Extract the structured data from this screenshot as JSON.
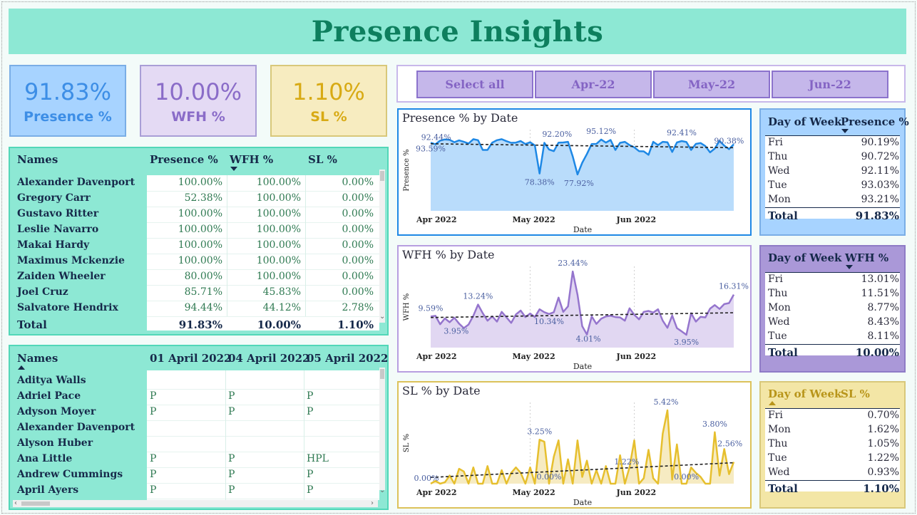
{
  "title": "Presence Insights",
  "kpis": {
    "presence": {
      "value": "91.83%",
      "label": "Presence %"
    },
    "wfh": {
      "value": "10.00%",
      "label": "WFH %"
    },
    "sl": {
      "value": "1.10%",
      "label": "SL %"
    }
  },
  "slicer": {
    "options": [
      "Select all",
      "Apr-22",
      "May-22",
      "Jun-22"
    ]
  },
  "summary_table": {
    "headers": [
      "Names",
      "Presence %",
      "WFH %",
      "SL %"
    ],
    "rows": [
      [
        "Alexander Davenport",
        "100.00%",
        "100.00%",
        "0.00%"
      ],
      [
        "Gregory Carr",
        "52.38%",
        "100.00%",
        "0.00%"
      ],
      [
        "Gustavo Ritter",
        "100.00%",
        "100.00%",
        "0.00%"
      ],
      [
        "Leslie Navarro",
        "100.00%",
        "100.00%",
        "0.00%"
      ],
      [
        "Makai Hardy",
        "100.00%",
        "100.00%",
        "0.00%"
      ],
      [
        "Maximus Mckenzie",
        "100.00%",
        "100.00%",
        "0.00%"
      ],
      [
        "Zaiden Wheeler",
        "80.00%",
        "100.00%",
        "0.00%"
      ],
      [
        "Joel Cruz",
        "85.71%",
        "45.83%",
        "0.00%"
      ],
      [
        "Salvatore Hendrix",
        "94.44%",
        "44.12%",
        "2.78%"
      ]
    ],
    "total": [
      "Total",
      "91.83%",
      "10.00%",
      "1.10%"
    ]
  },
  "attendance_table": {
    "headers": [
      "Names",
      "01 April 2022",
      "04 April 2022",
      "05 April 2022"
    ],
    "rows": [
      [
        "Aditya Walls",
        "",
        "",
        ""
      ],
      [
        "Adriel Pace",
        "P",
        "P",
        "P"
      ],
      [
        "Adyson Moyer",
        "P",
        "P",
        "P"
      ],
      [
        "Alexander Davenport",
        "",
        "",
        ""
      ],
      [
        "Alyson Huber",
        "",
        "",
        ""
      ],
      [
        "Ana Little",
        "P",
        "P",
        "HPL"
      ],
      [
        "Andrew Cummings",
        "P",
        "P",
        "P"
      ],
      [
        "April Ayers",
        "P",
        "P",
        "P"
      ]
    ]
  },
  "dow_tables": {
    "presence": {
      "headers": [
        "Day of Week",
        "Presence %"
      ],
      "rows": [
        [
          "Fri",
          "90.19%"
        ],
        [
          "Thu",
          "90.72%"
        ],
        [
          "Wed",
          "92.11%"
        ],
        [
          "Tue",
          "93.03%"
        ],
        [
          "Mon",
          "93.21%"
        ]
      ],
      "total": [
        "Total",
        "91.83%"
      ]
    },
    "wfh": {
      "headers": [
        "Day of Week",
        "WFH %"
      ],
      "rows": [
        [
          "Fri",
          "13.01%"
        ],
        [
          "Thu",
          "11.51%"
        ],
        [
          "Mon",
          "8.77%"
        ],
        [
          "Wed",
          "8.43%"
        ],
        [
          "Tue",
          "8.11%"
        ]
      ],
      "total": [
        "Total",
        "10.00%"
      ]
    },
    "sl": {
      "headers": [
        "Day of Week",
        "SL %"
      ],
      "rows": [
        [
          "Fri",
          "0.70%"
        ],
        [
          "Mon",
          "1.62%"
        ],
        [
          "Thu",
          "1.05%"
        ],
        [
          "Tue",
          "1.22%"
        ],
        [
          "Wed",
          "0.93%"
        ]
      ],
      "total": [
        "Total",
        "1.10%"
      ]
    }
  },
  "colors": {
    "presence": "#1e88e5",
    "presence_fill": "#b9dcfb",
    "wfh": "#9575cd",
    "wfh_fill": "#e1d7f2",
    "sl": "#e6bf2e",
    "sl_fill": "#f6ebc2"
  },
  "chart_data": [
    {
      "type": "area",
      "title": "Presence % by Date",
      "xlabel": "Date",
      "ylabel": "Presence %",
      "x_ticks": [
        "Apr 2022",
        "May 2022",
        "Jun 2022"
      ],
      "x": [
        "2022-04-01",
        "2022-04-04",
        "2022-04-05",
        "2022-04-06",
        "2022-04-07",
        "2022-04-08",
        "2022-04-11",
        "2022-04-12",
        "2022-04-13",
        "2022-04-14",
        "2022-04-15",
        "2022-04-18",
        "2022-04-19",
        "2022-04-20",
        "2022-04-21",
        "2022-04-22",
        "2022-04-25",
        "2022-04-26",
        "2022-04-27",
        "2022-04-28",
        "2022-04-29",
        "2022-05-02",
        "2022-05-03",
        "2022-05-04",
        "2022-05-05",
        "2022-05-06",
        "2022-05-09",
        "2022-05-10",
        "2022-05-11",
        "2022-05-12",
        "2022-05-13",
        "2022-05-16",
        "2022-05-17",
        "2022-05-18",
        "2022-05-19",
        "2022-05-20",
        "2022-05-23",
        "2022-05-24",
        "2022-05-25",
        "2022-05-26",
        "2022-05-27",
        "2022-05-30",
        "2022-05-31",
        "2022-06-01",
        "2022-06-02",
        "2022-06-03",
        "2022-06-06",
        "2022-06-07",
        "2022-06-08",
        "2022-06-09",
        "2022-06-10",
        "2022-06-13",
        "2022-06-14",
        "2022-06-15",
        "2022-06-16",
        "2022-06-17",
        "2022-06-20",
        "2022-06-21",
        "2022-06-22",
        "2022-06-23",
        "2022-06-24",
        "2022-06-27",
        "2022-06-28",
        "2022-06-29",
        "2022-06-30"
      ],
      "values": [
        93.59,
        92.8,
        94.6,
        95.2,
        95.0,
        93.8,
        94.7,
        94.0,
        93.2,
        95.3,
        94.8,
        90.0,
        90.0,
        93.6,
        94.8,
        95.3,
        94.3,
        93.5,
        93.6,
        94.4,
        92.9,
        93.8,
        92.2,
        78.38,
        93.5,
        90.2,
        89.4,
        93.6,
        93.7,
        94.0,
        86.8,
        77.92,
        83.7,
        88.0,
        92.9,
        93.0,
        95.12,
        93.6,
        94.9,
        90.0,
        93.5,
        94.0,
        92.4,
        91.3,
        89.4,
        89.3,
        87.6,
        94.0,
        92.4,
        94.0,
        93.8,
        89.0,
        93.7,
        94.4,
        93.9,
        90.0,
        93.0,
        93.4,
        91.9,
        88.8,
        90.7,
        94.5,
        92.1,
        90.38,
        92.8
      ],
      "data_labels": [
        {
          "x": "2022-04-01",
          "label": "93.59%"
        },
        {
          "x": "2022-04-04",
          "label": "92.44%"
        },
        {
          "x": "2022-05-04",
          "label": "78.38%"
        },
        {
          "x": "2022-05-09",
          "label": "92.20%"
        },
        {
          "x": "2022-05-16",
          "label": "77.92%"
        },
        {
          "x": "2022-05-23",
          "label": "95.12%"
        },
        {
          "x": "2022-06-14",
          "label": "92.41%"
        },
        {
          "x": "2022-06-28",
          "label": "90.38%"
        }
      ],
      "trendline": true,
      "ylim": [
        60,
        100
      ]
    },
    {
      "type": "area",
      "title": "WFH % by Date",
      "xlabel": "Date",
      "ylabel": "WFH %",
      "x_ticks": [
        "Apr 2022",
        "May 2022",
        "Jun 2022"
      ],
      "values": [
        9.59,
        9.8,
        7.2,
        9.0,
        7.8,
        9.2,
        7.4,
        6.0,
        7.1,
        9.8,
        13.24,
        10.6,
        8.3,
        9.6,
        8.0,
        11.0,
        9.3,
        7.6,
        10.2,
        11.4,
        9.4,
        10.5,
        9.4,
        11.8,
        10.9,
        10.34,
        10.9,
        15.4,
        11.0,
        12.7,
        23.44,
        16.3,
        6.6,
        4.01,
        9.6,
        7.3,
        8.9,
        9.6,
        9.8,
        9.4,
        9.3,
        8.3,
        12.1,
        10.1,
        8.7,
        11.0,
        11.3,
        10.8,
        11.8,
        8.3,
        6.1,
        9.9,
        6.0,
        5.0,
        3.95,
        10.6,
        8.0,
        9.5,
        9.3,
        12.0,
        13.1,
        11.9,
        13.4,
        13.7,
        16.31
      ],
      "data_labels": [
        {
          "label": "9.59%"
        },
        {
          "label": "3.95%"
        },
        {
          "label": "13.24%"
        },
        {
          "label": "23.44%"
        },
        {
          "label": "10.34%"
        },
        {
          "label": "4.01%"
        },
        {
          "label": "3.95%"
        },
        {
          "label": "16.31%"
        }
      ],
      "trendline": true,
      "ylim": [
        0,
        25
      ]
    },
    {
      "type": "area",
      "title": "SL % by Date",
      "xlabel": "Date",
      "ylabel": "SL %",
      "x_ticks": [
        "Apr 2022",
        "May 2022",
        "Jun 2022"
      ],
      "values": [
        0.0,
        0.2,
        0.0,
        0.1,
        0.6,
        0.0,
        1.1,
        0.9,
        0.0,
        1.2,
        0.0,
        0.0,
        1.3,
        0.0,
        0.0,
        1.0,
        0.0,
        0.8,
        1.2,
        0.8,
        0.0,
        1.2,
        0.0,
        3.25,
        3.1,
        0.0,
        2.0,
        3.2,
        0.0,
        1.8,
        0.0,
        3.2,
        0.5,
        1.7,
        0.0,
        1.0,
        0.0,
        1.3,
        0.0,
        0.0,
        2.1,
        0.0,
        1.22,
        3.2,
        0.0,
        0.4,
        2.5,
        0.4,
        0.0,
        3.7,
        5.42,
        0.3,
        2.9,
        0.0,
        0.0,
        1.2,
        0.8,
        0.5,
        0.0,
        0.0,
        3.8,
        0.6,
        2.56,
        0.7,
        1.6
      ],
      "data_labels": [
        {
          "label": "0.00%"
        },
        {
          "label": "3.25%"
        },
        {
          "label": "0.00%"
        },
        {
          "label": "1.22%"
        },
        {
          "label": "5.42%"
        },
        {
          "label": "0.00%"
        },
        {
          "label": "3.80%"
        },
        {
          "label": "2.56%"
        }
      ],
      "trendline": true,
      "ylim": [
        0,
        6
      ]
    }
  ]
}
